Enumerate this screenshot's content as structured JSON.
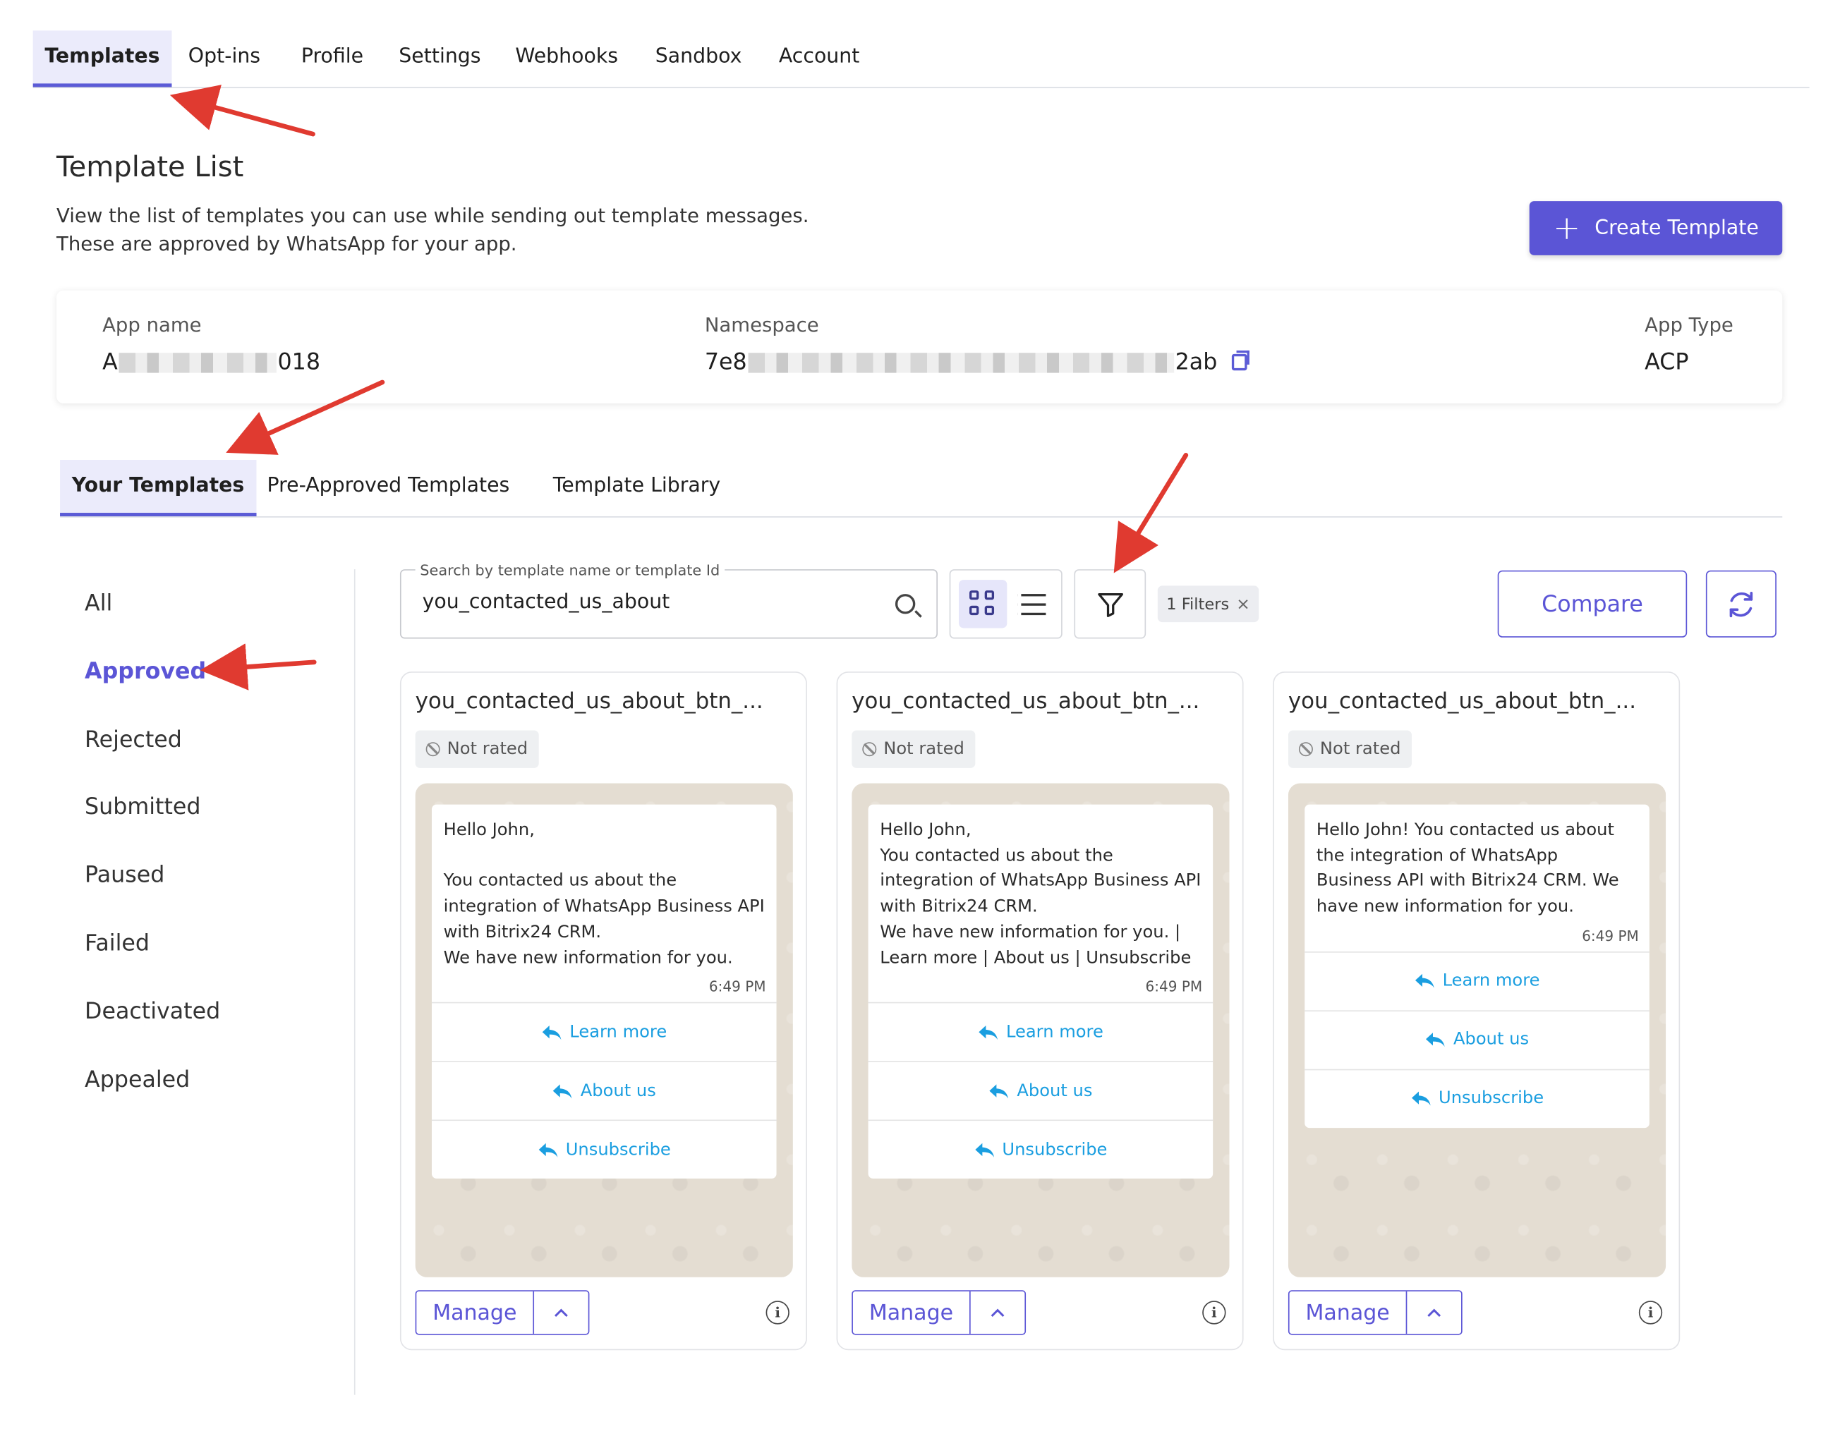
{
  "top_nav": {
    "tabs": [
      {
        "label": "Templates",
        "active": true
      },
      {
        "label": "Opt-ins"
      },
      {
        "label": "Profile"
      },
      {
        "label": "Settings"
      },
      {
        "label": "Webhooks"
      },
      {
        "label": "Sandbox"
      },
      {
        "label": "Account"
      }
    ]
  },
  "header": {
    "title": "Template List",
    "description_line1": "View the list of templates you can use while sending out template messages.",
    "description_line2": "These are approved by WhatsApp for your app.",
    "create_button": "Create Template"
  },
  "app_info": {
    "app_name_label": "App name",
    "app_name_prefix": "A",
    "app_name_suffix": "018",
    "namespace_label": "Namespace",
    "namespace_prefix": "7e8",
    "namespace_suffix": "2ab",
    "app_type_label": "App Type",
    "app_type_value": "ACP"
  },
  "sub_tabs": [
    {
      "label": "Your Templates",
      "active": true
    },
    {
      "label": "Pre-Approved Templates"
    },
    {
      "label": "Template Library"
    }
  ],
  "status_filters": [
    {
      "label": "All"
    },
    {
      "label": "Approved",
      "active": true
    },
    {
      "label": "Rejected"
    },
    {
      "label": "Submitted"
    },
    {
      "label": "Paused"
    },
    {
      "label": "Failed"
    },
    {
      "label": "Deactivated"
    },
    {
      "label": "Appealed"
    }
  ],
  "toolbar": {
    "search_legend": "Search by template name or template Id",
    "search_value": "you_contacted_us_about",
    "filter_chip": "1 Filters",
    "compare_label": "Compare"
  },
  "templates": [
    {
      "name": "you_contacted_us_about_btn_...",
      "rating": "Not rated",
      "message": "Hello John,\n\nYou contacted us about the integration of WhatsApp Business API with Bitrix24 CRM.\nWe have new information for you.",
      "time": "6:49 PM",
      "buttons": [
        "Learn more",
        "About us",
        "Unsubscribe"
      ],
      "manage_label": "Manage"
    },
    {
      "name": "you_contacted_us_about_btn_...",
      "rating": "Not rated",
      "message": "Hello John,\nYou contacted us about the integration of WhatsApp Business API with Bitrix24 CRM.\nWe have new information for you. | Learn more | About us | Unsubscribe",
      "time": "6:49 PM",
      "buttons": [
        "Learn more",
        "About us",
        "Unsubscribe"
      ],
      "manage_label": "Manage"
    },
    {
      "name": "you_contacted_us_about_btn_...",
      "rating": "Not rated",
      "message": "Hello John! You contacted us about the integration of WhatsApp Business API with Bitrix24 CRM. We have new information for you.",
      "time": "6:49 PM",
      "buttons": [
        "Learn more",
        "About us",
        "Unsubscribe"
      ],
      "manage_label": "Manage"
    }
  ],
  "colors": {
    "accent": "#5b55d6",
    "tab_active_bg": "#ebebfb",
    "quick_reply": "#1a9ee0",
    "annotation_arrow": "#e03a30",
    "chat_bg": "#e4ddd2"
  }
}
